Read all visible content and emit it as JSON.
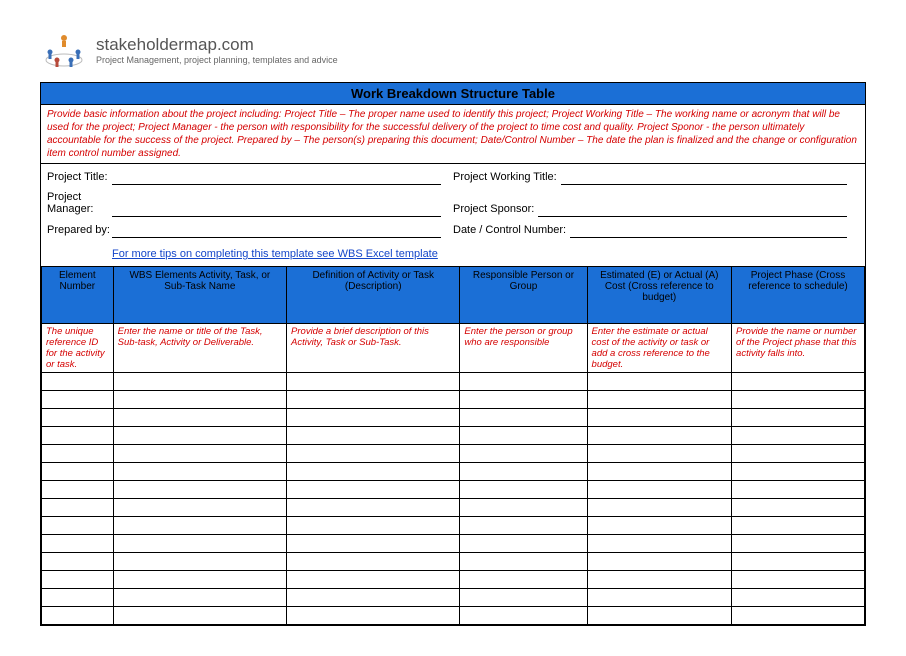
{
  "brand": {
    "title": "stakeholdermap.com",
    "sub": "Project Management, project planning, templates and advice"
  },
  "doc_title": "Work Breakdown Structure Table",
  "instructions": "Provide basic information about the project including: Project Title – The proper name used to identify this project; Project Working Title – The working name or acronym that will be used for the project; Project Manager - the person with responsibility for the successful delivery of the project to time cost and quality. Project Sponor - the person ultimately accountable for the success of the project. Prepared by – The person(s) preparing this document; Date/Control Number – The date the plan is finalized and the change or configuration item control number assigned.",
  "meta": {
    "project_title_label": "Project Title:",
    "working_title_label": "Project Working Title:",
    "project_manager_label": "Project Manager:",
    "sponsor_label": "Project Sponsor:",
    "prepared_by_label": "Prepared by:",
    "date_control_label": "Date / Control Number:"
  },
  "tips_link": "For more tips on completing this template see WBS Excel template",
  "columns": [
    "Element Number",
    "WBS Elements\nActivity, Task, or Sub-Task Name",
    "Definition of Activity or Task (Description)",
    "Responsible Person or Group",
    "Estimated (E) or Actual (A) Cost (Cross reference to budget)",
    "Project Phase (Cross reference to schedule)"
  ],
  "helpers": [
    "The unique reference ID for the activity or task.",
    "Enter the name or title of the Task, Sub-task, Activity or Deliverable.",
    "Provide a brief description of this Activity, Task or Sub-Task.",
    "Enter the person or group who are responsible",
    "Enter the estimate or actual cost of the activity or task or add a cross reference to the budget.",
    "Provide the name or number of the Project phase that this activity falls into."
  ],
  "blank_rows": 14
}
